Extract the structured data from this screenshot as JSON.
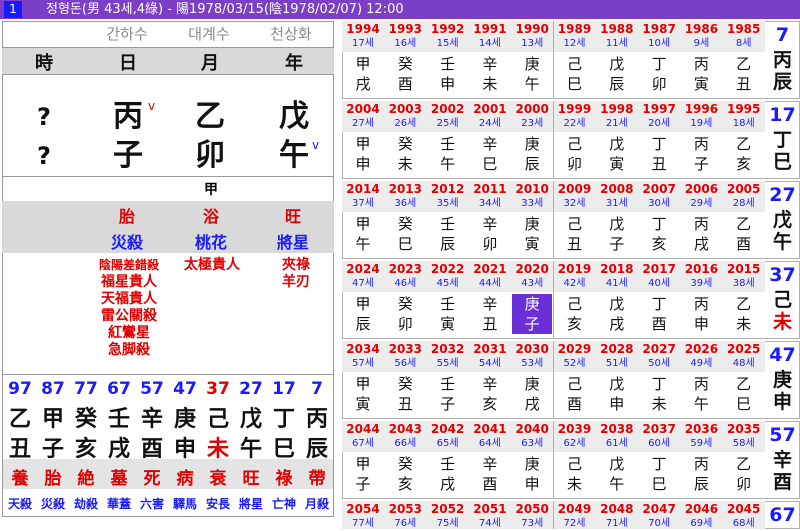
{
  "title": {
    "index": "1",
    "text": "정형돈(男 43세,4綠) - 陽1978/03/15(陰1978/02/07) 12:00"
  },
  "saju": {
    "gz_korean": [
      "간하수",
      "대계수",
      "천상화"
    ],
    "pillar_headers": [
      "時",
      "日",
      "月",
      "年"
    ],
    "stems": [
      "?",
      "丙",
      "乙",
      "戊"
    ],
    "branches": [
      "?",
      "子",
      "卯",
      "午"
    ],
    "marks": {
      "stem_day": "v",
      "branch_year": "v"
    },
    "jijang": "甲",
    "twelve_stage": [
      "胎",
      "浴",
      "旺"
    ],
    "twelve_sinsal": [
      "災殺",
      "桃花",
      "將星"
    ],
    "sinsal_day": [
      "陰陽差錯殺",
      "福星貴人",
      "天福貴人",
      "雷公關殺",
      "紅鸞星",
      "急脚殺"
    ],
    "sinsal_month": [
      "太極貴人"
    ],
    "sinsal_year": [
      "夾祿",
      "羊刃"
    ]
  },
  "daewoon": {
    "ages": [
      "97",
      "87",
      "77",
      "67",
      "57",
      "47",
      "37",
      "27",
      "17",
      "7"
    ],
    "stems": [
      "乙",
      "甲",
      "癸",
      "壬",
      "辛",
      "庚",
      "己",
      "戊",
      "丁",
      "丙"
    ],
    "branches": [
      "丑",
      "子",
      "亥",
      "戌",
      "酉",
      "申",
      "未",
      "午",
      "巳",
      "辰"
    ],
    "stages": [
      "養",
      "胎",
      "絶",
      "墓",
      "死",
      "病",
      "衰",
      "旺",
      "祿",
      "帶"
    ],
    "sinsal": [
      "天殺",
      "災殺",
      "劫殺",
      "華蓋",
      "六害",
      "驛馬",
      "安長",
      "將星",
      "亡神",
      "月殺"
    ]
  },
  "decades": [
    {
      "years": [
        "1994",
        "1993",
        "1992",
        "1991",
        "1990",
        "1989",
        "1988",
        "1987",
        "1986",
        "1985"
      ],
      "ages": [
        "17세",
        "16세",
        "15세",
        "14세",
        "13세",
        "12세",
        "11세",
        "10세",
        "9세",
        "8세"
      ],
      "stems": [
        "甲",
        "癸",
        "壬",
        "辛",
        "庚",
        "己",
        "戊",
        "丁",
        "丙",
        "乙"
      ],
      "branches": [
        "戌",
        "酉",
        "申",
        "未",
        "午",
        "巳",
        "辰",
        "卯",
        "寅",
        "丑"
      ],
      "dae_age": "7",
      "dae_stem": "丙",
      "dae_branch": "辰"
    },
    {
      "years": [
        "2004",
        "2003",
        "2002",
        "2001",
        "2000",
        "1999",
        "1998",
        "1997",
        "1996",
        "1995"
      ],
      "ages": [
        "27세",
        "26세",
        "25세",
        "24세",
        "23세",
        "22세",
        "21세",
        "20세",
        "19세",
        "18세"
      ],
      "stems": [
        "甲",
        "癸",
        "壬",
        "辛",
        "庚",
        "己",
        "戊",
        "丁",
        "丙",
        "乙"
      ],
      "branches": [
        "申",
        "未",
        "午",
        "巳",
        "辰",
        "卯",
        "寅",
        "丑",
        "子",
        "亥"
      ],
      "dae_age": "17",
      "dae_stem": "丁",
      "dae_branch": "巳"
    },
    {
      "years": [
        "2014",
        "2013",
        "2012",
        "2011",
        "2010",
        "2009",
        "2008",
        "2007",
        "2006",
        "2005"
      ],
      "ages": [
        "37세",
        "36세",
        "35세",
        "34세",
        "33세",
        "32세",
        "31세",
        "30세",
        "29세",
        "28세"
      ],
      "stems": [
        "甲",
        "癸",
        "壬",
        "辛",
        "庚",
        "己",
        "戊",
        "丁",
        "丙",
        "乙"
      ],
      "branches": [
        "午",
        "巳",
        "辰",
        "卯",
        "寅",
        "丑",
        "子",
        "亥",
        "戌",
        "酉"
      ],
      "dae_age": "27",
      "dae_stem": "戊",
      "dae_branch": "午"
    },
    {
      "years": [
        "2024",
        "2023",
        "2022",
        "2021",
        "2020",
        "2019",
        "2018",
        "2017",
        "2016",
        "2015"
      ],
      "ages": [
        "47세",
        "46세",
        "45세",
        "44세",
        "43세",
        "42세",
        "41세",
        "40세",
        "39세",
        "38세"
      ],
      "stems": [
        "甲",
        "癸",
        "壬",
        "辛",
        "庚",
        "己",
        "戊",
        "丁",
        "丙",
        "乙"
      ],
      "branches": [
        "辰",
        "卯",
        "寅",
        "丑",
        "子",
        "亥",
        "戌",
        "酉",
        "申",
        "未"
      ],
      "dae_age": "37",
      "dae_stem": "己",
      "dae_branch": "未"
    },
    {
      "years": [
        "2034",
        "2033",
        "2032",
        "2031",
        "2030",
        "2029",
        "2028",
        "2027",
        "2026",
        "2025"
      ],
      "ages": [
        "57세",
        "56세",
        "55세",
        "54세",
        "53세",
        "52세",
        "51세",
        "50세",
        "49세",
        "48세"
      ],
      "stems": [
        "甲",
        "癸",
        "壬",
        "辛",
        "庚",
        "己",
        "戊",
        "丁",
        "丙",
        "乙"
      ],
      "branches": [
        "寅",
        "丑",
        "子",
        "亥",
        "戌",
        "酉",
        "申",
        "未",
        "午",
        "巳"
      ],
      "dae_age": "47",
      "dae_stem": "庚",
      "dae_branch": "申"
    },
    {
      "years": [
        "2044",
        "2043",
        "2042",
        "2041",
        "2040",
        "2039",
        "2038",
        "2037",
        "2036",
        "2035"
      ],
      "ages": [
        "67세",
        "66세",
        "65세",
        "64세",
        "63세",
        "62세",
        "61세",
        "60세",
        "59세",
        "58세"
      ],
      "stems": [
        "甲",
        "癸",
        "壬",
        "辛",
        "庚",
        "己",
        "戊",
        "丁",
        "丙",
        "乙"
      ],
      "branches": [
        "子",
        "亥",
        "戌",
        "酉",
        "申",
        "未",
        "午",
        "巳",
        "辰",
        "卯"
      ],
      "dae_age": "57",
      "dae_stem": "辛",
      "dae_branch": "酉"
    },
    {
      "years": [
        "2054",
        "2053",
        "2052",
        "2051",
        "2050",
        "2049",
        "2048",
        "2047",
        "2046",
        "2045"
      ],
      "ages": [
        "77세",
        "76세",
        "75세",
        "74세",
        "73세",
        "72세",
        "71세",
        "70세",
        "69세",
        "68세"
      ],
      "stems": [],
      "branches": [],
      "dae_age": "67",
      "dae_stem": "",
      "dae_branch": ""
    }
  ],
  "colors": {
    "title_bar": "#7b3fc6",
    "highlight": "#6a2fd6",
    "year_red": "#e00000",
    "age_blue": "#1a1aff"
  },
  "current_year": "2020"
}
